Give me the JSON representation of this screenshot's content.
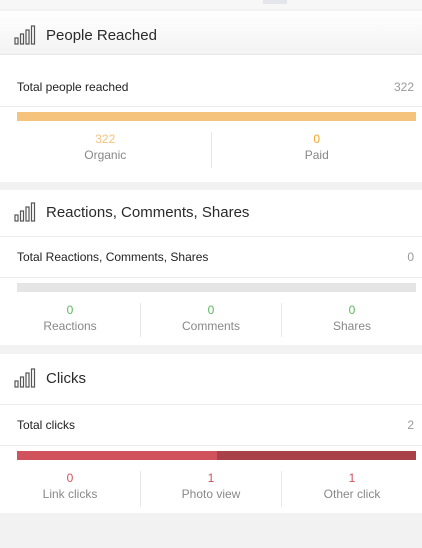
{
  "colors": {
    "orange": "#f5a623",
    "green": "#5cb85c",
    "red": "#d0525c",
    "red_dark": "#a8414a",
    "bar_orange": "#f6c37c"
  },
  "reach": {
    "title": "People Reached",
    "icon": "bar-chart-icon",
    "total_label": "Total people reached",
    "total_value": "322",
    "organic_value": "322",
    "organic_label": "Organic",
    "paid_value": "0",
    "paid_label": "Paid",
    "organic_fraction": 1.0
  },
  "reactions": {
    "title": "Reactions, Comments, Shares",
    "icon": "bar-chart-icon",
    "total_label": "Total Reactions, Comments, Shares",
    "total_value": "0",
    "reactions_value": "0",
    "reactions_label": "Reactions",
    "comments_value": "0",
    "comments_label": "Comments",
    "shares_value": "0",
    "shares_label": "Shares"
  },
  "clicks": {
    "title": "Clicks",
    "icon": "bar-chart-icon",
    "total_label": "Total clicks",
    "total_value": "2",
    "link_value": "0",
    "link_label": "Link clicks",
    "photo_value": "1",
    "photo_label": "Photo view",
    "other_value": "1",
    "other_label": "Other click",
    "photo_fraction": 0.5,
    "other_fraction": 0.5
  }
}
